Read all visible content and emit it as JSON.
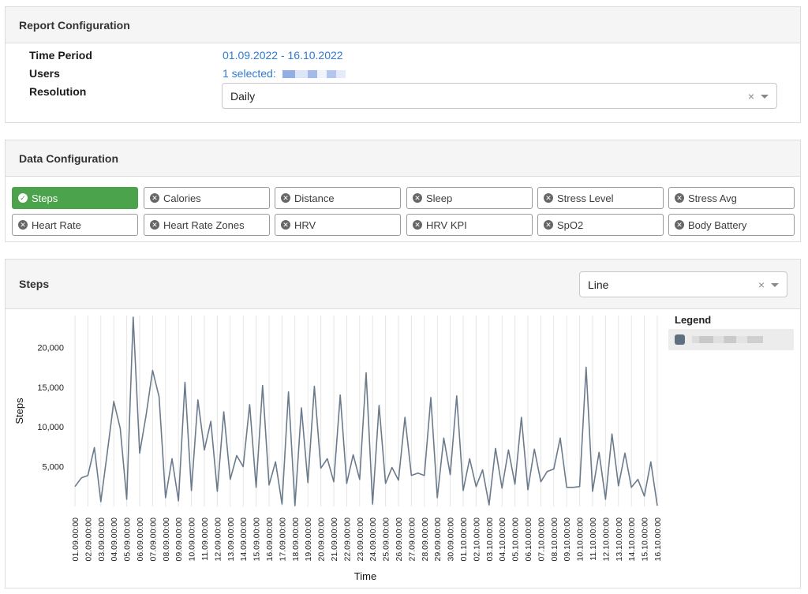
{
  "report": {
    "title": "Report Configuration",
    "time_period_label": "Time Period",
    "time_period_value": "01.09.2022 - 16.10.2022",
    "users_label": "Users",
    "users_value": "1 selected:",
    "resolution_label": "Resolution",
    "resolution_value": "Daily"
  },
  "data_config": {
    "title": "Data Configuration",
    "chips": [
      {
        "label": "Steps",
        "active": true
      },
      {
        "label": "Calories",
        "active": false
      },
      {
        "label": "Distance",
        "active": false
      },
      {
        "label": "Sleep",
        "active": false
      },
      {
        "label": "Stress Level",
        "active": false
      },
      {
        "label": "Stress Avg",
        "active": false
      },
      {
        "label": "Heart Rate",
        "active": false
      },
      {
        "label": "Heart Rate Zones",
        "active": false
      },
      {
        "label": "HRV",
        "active": false
      },
      {
        "label": "HRV KPI",
        "active": false
      },
      {
        "label": "SpO2",
        "active": false
      },
      {
        "label": "Body Battery",
        "active": false
      }
    ]
  },
  "chart_panel": {
    "title": "Steps",
    "chart_type_value": "Line",
    "legend_title": "Legend",
    "line_color": "#6b7b8c"
  },
  "chart_data": {
    "type": "line",
    "xlabel": "Time",
    "ylabel": "Steps",
    "ylim": [
      0,
      24000
    ],
    "yticks": [
      "5,000",
      "10,000",
      "15,000",
      "20,000"
    ],
    "ytick_values": [
      5000,
      10000,
      15000,
      20000
    ],
    "grid": "vertical",
    "legend_position": "right",
    "x": [
      "01.09.00:00",
      "02.09.00:00",
      "03.09.00:00",
      "04.09.00:00",
      "05.09.00:00",
      "06.09.00:00",
      "07.09.00:00",
      "08.09.00:00",
      "09.09.00:00",
      "10.09.00:00",
      "11.09.00:00",
      "12.09.00:00",
      "13.09.00:00",
      "14.09.00:00",
      "15.09.00:00",
      "16.09.00:00",
      "17.09.00:00",
      "18.09.00:00",
      "19.09.00:00",
      "20.09.00:00",
      "21.09.00:00",
      "22.09.00:00",
      "23.09.00:00",
      "24.09.00:00",
      "25.09.00:00",
      "26.09.00:00",
      "27.09.00:00",
      "28.09.00:00",
      "29.09.00:00",
      "30.09.00:00",
      "01.10.00:00",
      "02.10.00:00",
      "03.10.00:00",
      "04.10.00:00",
      "05.10.00:00",
      "06.10.00:00",
      "07.10.00:00",
      "08.10.00:00",
      "09.10.00:00",
      "10.10.00:00",
      "11.10.00:00",
      "12.10.00:00",
      "13.10.00:00",
      "14.10.00:00",
      "15.10.00:00",
      "16.10.00:00"
    ],
    "values": [
      2500,
      3600,
      3900,
      7400,
      600,
      6800,
      13200,
      9800,
      900,
      23800,
      6700,
      11500,
      17100,
      13800,
      1100,
      6000,
      700,
      15600,
      2000,
      13400,
      7100,
      10700,
      1900,
      11900,
      3400,
      6400,
      5000,
      12800,
      2400,
      15200,
      2700,
      5600,
      300,
      14400,
      100,
      12400,
      3000,
      15100,
      4800,
      6000,
      3100,
      14000,
      2900,
      6500,
      3400,
      16800,
      300,
      12700,
      2900,
      4900,
      3300,
      11200,
      3900,
      4200,
      3900,
      13700,
      1100,
      8600,
      4000,
      13900,
      2000,
      6000,
      2500,
      4600,
      200,
      7300,
      2300,
      7100,
      2800,
      11200,
      2100,
      7200,
      3100,
      4400,
      4700,
      8600,
      2400,
      2400,
      2500,
      17500,
      1900,
      6800,
      900,
      9100,
      2600,
      6700,
      2400,
      3400,
      1300,
      5600,
      100
    ]
  }
}
